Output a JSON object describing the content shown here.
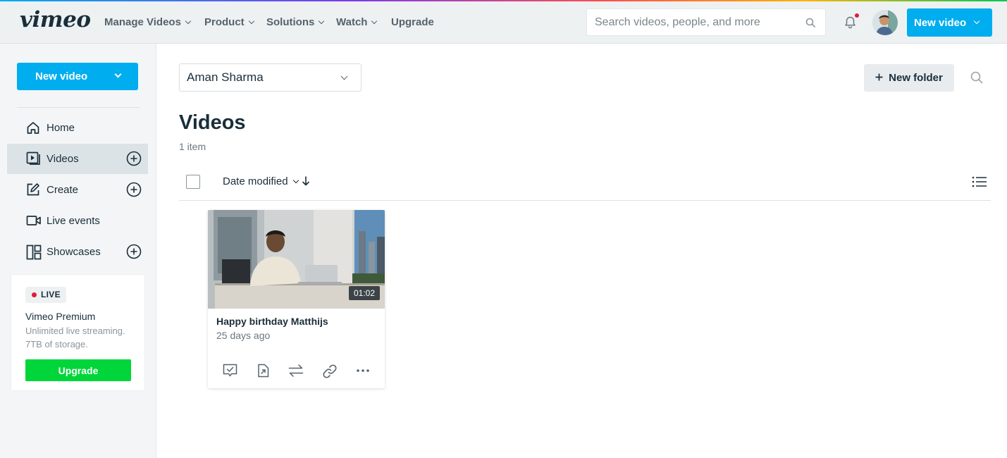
{
  "app": {
    "logo": "vimeo"
  },
  "topnav": {
    "items": [
      {
        "label": "Manage Videos",
        "has_menu": true
      },
      {
        "label": "Product",
        "has_menu": true
      },
      {
        "label": "Solutions",
        "has_menu": true
      },
      {
        "label": "Watch",
        "has_menu": true
      },
      {
        "label": "Upgrade",
        "has_menu": false
      }
    ],
    "search_placeholder": "Search videos, people, and more",
    "new_video_label": "New video",
    "notification_dot_color": "#e01b3c"
  },
  "sidebar": {
    "new_video_label": "New video",
    "items": [
      {
        "label": "Home",
        "icon": "home-icon",
        "active": false,
        "has_add": false
      },
      {
        "label": "Videos",
        "icon": "video-library-icon",
        "active": true,
        "has_add": true
      },
      {
        "label": "Create",
        "icon": "create-icon",
        "active": false,
        "has_add": true
      },
      {
        "label": "Live events",
        "icon": "camera-icon",
        "active": false,
        "has_add": false
      },
      {
        "label": "Showcases",
        "icon": "showcase-icon",
        "active": false,
        "has_add": true
      }
    ],
    "premium": {
      "badge": "LIVE",
      "title": "Vimeo Premium",
      "description": "Unlimited live streaming. 7TB of storage.",
      "button": "Upgrade"
    }
  },
  "main": {
    "owner": "Aman Sharma",
    "new_folder_label": "New folder",
    "title": "Videos",
    "item_count": "1 item",
    "sort_label": "Date modified",
    "videos": [
      {
        "title": "Happy birthday Matthijs",
        "age": "25 days ago",
        "duration": "01:02"
      }
    ]
  },
  "colors": {
    "accent": "#00adef",
    "upgrade_green": "#00d639",
    "text": "#1a2e3b"
  }
}
